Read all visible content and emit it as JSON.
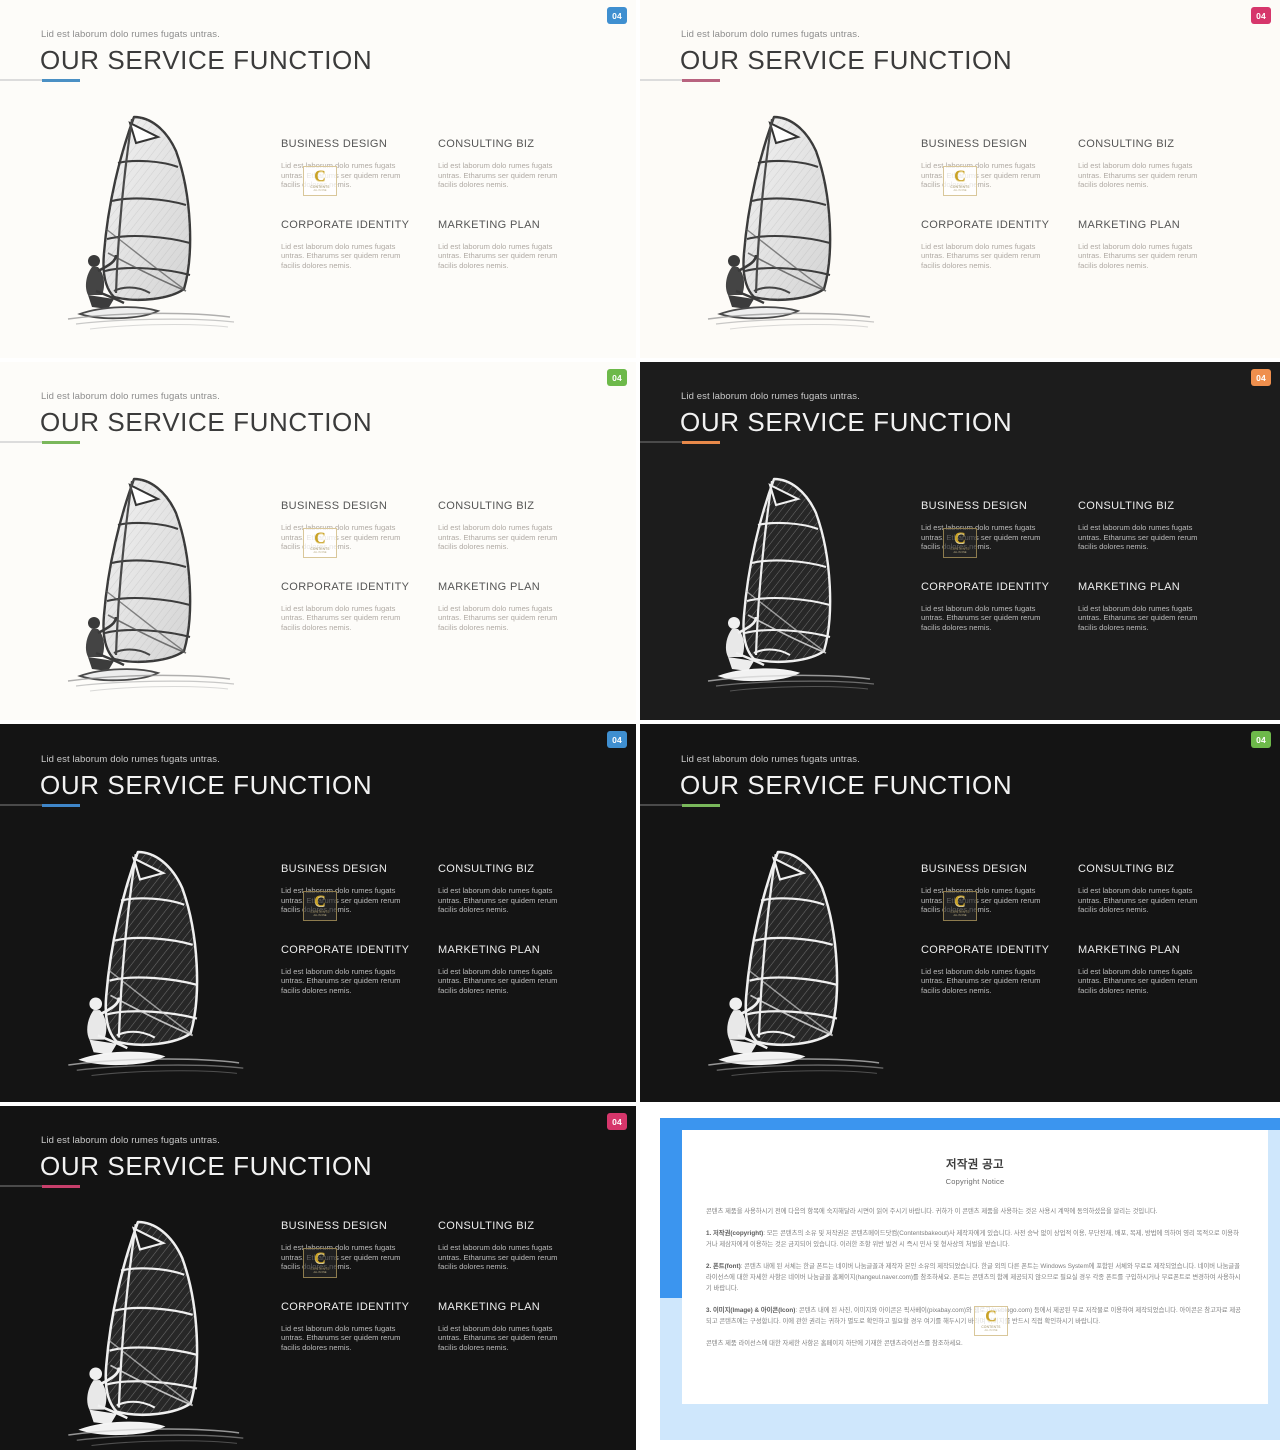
{
  "slides": [
    {
      "id": "slide-blue-light",
      "theme": "light",
      "badge": "04",
      "accent": "#4a90c4",
      "badge_color": "#3f8fd0",
      "eyebrow": "Lid est laborum dolo rumes fugats untras.",
      "title": "OUR SERVICE FUNCTION",
      "items": [
        {
          "heading": "BUSINESS DESIGN",
          "body": "Lid est laborum dolo rumes fugats untras. Etharums ser quidem rerum facilis dolores nemis."
        },
        {
          "heading": "CONSULTING BIZ",
          "body": "Lid est laborum dolo rumes fugats untras. Etharums ser quidem rerum facilis dolores nemis."
        },
        {
          "heading": "CORPORATE IDENTITY",
          "body": "Lid est laborum dolo rumes fugats untras. Etharums ser quidem rerum facilis dolores nemis."
        },
        {
          "heading": "MARKETING PLAN",
          "body": "Lid est laborum dolo rumes fugats untras. Etharums ser quidem rerum facilis dolores nemis."
        }
      ]
    },
    {
      "id": "slide-pink-light",
      "theme": "light2",
      "badge": "04",
      "accent": "#b8637f",
      "badge_color": "#d6366b",
      "eyebrow": "Lid est laborum dolo rumes fugats untras.",
      "title": "OUR SERVICE FUNCTION",
      "items": [
        {
          "heading": "BUSINESS DESIGN",
          "body": "Lid est laborum dolo rumes fugats untras. Etharums ser quidem rerum facilis dolores nemis."
        },
        {
          "heading": "CONSULTING BIZ",
          "body": "Lid est laborum dolo rumes fugats untras. Etharums ser quidem rerum facilis dolores nemis."
        },
        {
          "heading": "CORPORATE IDENTITY",
          "body": "Lid est laborum dolo rumes fugats untras. Etharums ser quidem rerum facilis dolores nemis."
        },
        {
          "heading": "MARKETING PLAN",
          "body": "Lid est laborum dolo rumes fugats untras. Etharums ser quidem rerum facilis dolores nemis."
        }
      ]
    },
    {
      "id": "slide-green-light",
      "theme": "light",
      "badge": "04",
      "accent": "#7ab75b",
      "badge_color": "#6db94a",
      "eyebrow": "Lid est laborum dolo rumes fugats untras.",
      "title": "OUR SERVICE FUNCTION",
      "items": [
        {
          "heading": "BUSINESS DESIGN",
          "body": "Lid est laborum dolo rumes fugats untras. Etharums ser quidem rerum facilis dolores nemis."
        },
        {
          "heading": "CONSULTING BIZ",
          "body": "Lid est laborum dolo rumes fugats untras. Etharums ser quidem rerum facilis dolores nemis."
        },
        {
          "heading": "CORPORATE IDENTITY",
          "body": "Lid est laborum dolo rumes fugats untras. Etharums ser quidem rerum facilis dolores nemis."
        },
        {
          "heading": "MARKETING PLAN",
          "body": "Lid est laborum dolo rumes fugats untras. Etharums ser quidem rerum facilis dolores nemis."
        }
      ]
    },
    {
      "id": "slide-orange-dark",
      "theme": "dark",
      "badge": "04",
      "accent": "#e8894a",
      "badge_color": "#ef8f4d",
      "eyebrow": "Lid est laborum dolo rumes fugats untras.",
      "title": "OUR SERVICE FUNCTION",
      "items": [
        {
          "heading": "BUSINESS DESIGN",
          "body": "Lid est laborum dolo rumes fugats untras. Etharums ser quidem rerum facilis dolores nemis."
        },
        {
          "heading": "CONSULTING BIZ",
          "body": "Lid est laborum dolo rumes fugats untras. Etharums ser quidem rerum facilis dolores nemis."
        },
        {
          "heading": "CORPORATE IDENTITY",
          "body": "Lid est laborum dolo rumes fugats untras. Etharums ser quidem rerum facilis dolores nemis."
        },
        {
          "heading": "MARKETING PLAN",
          "body": "Lid est laborum dolo rumes fugats untras. Etharums ser quidem rerum facilis dolores nemis."
        }
      ]
    },
    {
      "id": "slide-blue-dark",
      "theme": "dark2",
      "badge": "04",
      "accent": "#3f86c9",
      "badge_color": "#3f8fd0",
      "eyebrow": "Lid est laborum dolo rumes fugats untras.",
      "title": "OUR SERVICE FUNCTION",
      "items": [
        {
          "heading": "BUSINESS DESIGN",
          "body": "Lid est laborum dolo rumes fugats untras. Etharums ser quidem rerum facilis dolores nemis."
        },
        {
          "heading": "CONSULTING BIZ",
          "body": "Lid est laborum dolo rumes fugats untras. Etharums ser quidem rerum facilis dolores nemis."
        },
        {
          "heading": "CORPORATE IDENTITY",
          "body": "Lid est laborum dolo rumes fugats untras. Etharums ser quidem rerum facilis dolores nemis."
        },
        {
          "heading": "MARKETING PLAN",
          "body": "Lid est laborum dolo rumes fugats untras. Etharums ser quidem rerum facilis dolores nemis."
        }
      ]
    },
    {
      "id": "slide-green-dark",
      "theme": "dark2",
      "badge": "04",
      "accent": "#79b85b",
      "badge_color": "#6db94a",
      "eyebrow": "Lid est laborum dolo rumes fugats untras.",
      "title": "OUR SERVICE FUNCTION",
      "items": [
        {
          "heading": "BUSINESS DESIGN",
          "body": "Lid est laborum dolo rumes fugats untras. Etharums ser quidem rerum facilis dolores nemis."
        },
        {
          "heading": "CONSULTING BIZ",
          "body": "Lid est laborum dolo rumes fugats untras. Etharums ser quidem rerum facilis dolores nemis."
        },
        {
          "heading": "CORPORATE IDENTITY",
          "body": "Lid est laborum dolo rumes fugats untras. Etharums ser quidem rerum facilis dolores nemis."
        },
        {
          "heading": "MARKETING PLAN",
          "body": "Lid est laborum dolo rumes fugats untras. Etharums ser quidem rerum facilis dolores nemis."
        }
      ]
    },
    {
      "id": "slide-pink-dark",
      "theme": "dark3",
      "badge": "04",
      "accent": "#c73f6b",
      "badge_color": "#d6366b",
      "eyebrow": "Lid est laborum dolo rumes fugats untras.",
      "title": "OUR SERVICE FUNCTION",
      "items": [
        {
          "heading": "BUSINESS DESIGN",
          "body": "Lid est laborum dolo rumes fugats untras. Etharums ser quidem rerum facilis dolores nemis."
        },
        {
          "heading": "CONSULTING BIZ",
          "body": "Lid est laborum dolo rumes fugats untras. Etharums ser quidem rerum facilis dolores nemis."
        },
        {
          "heading": "CORPORATE IDENTITY",
          "body": "Lid est laborum dolo rumes fugats untras. Etharums ser quidem rerum facilis dolores nemis."
        },
        {
          "heading": "MARKETING PLAN",
          "body": "Lid est laborum dolo rumes fugats untras. Etharums ser quidem rerum facilis dolores nemis."
        }
      ]
    }
  ],
  "watermark": {
    "letter": "C",
    "line1": "CONTENTS",
    "line2": "ALL IN ONE"
  },
  "copyright": {
    "title": "저작권 공고",
    "subtitle": "Copyright Notice",
    "intro": "콘텐츠 제품을 사용하시기 전에 다음의 항목에 숙지해달라 시면이 읽어 주시기 바랍니다. 귀하가 이 콘텐츠 제품을 사용하는 것은 사용시 계약에 동의하셨음을 알리는 것입니다.",
    "p1_label": "1. 저작권(copyright)",
    "p1": ": 모든 콘텐츠의 소유 및 저작권은 콘텐츠메이드닷컴(Contentsbakeout)사 제작자에게 있습니다. 사전 승낙 없이 상업적 이용, 무단전재, 배포, 복제, 방법에 의하여 영리 목적으로 이용하거나 제삼자에게 이용하는 것은 금지되어 있습니다. 이러한 조항 위반 발견 시 즉시 민사 및 형사상의 처벌을 받습니다.",
    "p2_label": "2. 폰트(font)",
    "p2": ": 콘텐츠 내에 된 서체는 한글 폰트는 네이버 나눔글꼴과 제작자 본인 소유의 제작되었습니다. 한글 외의 다른 폰트는 Windows System에 포함된 서체와 무료로 제작되었습니다. 네이버 나눔글꼴 라이선스에 대한 자세한 사항은 네이버 나눔글꼴 홈페이지(hangeul.naver.com)를 참조하세요. 폰트는 콘텐츠의 함께 제공되지 않으므로 필요실 경우 각종 폰트를 구입하시거나 무료폰트로 변경하여 사용하시기 바랍니다.",
    "p3_label": "3. 이미지(Image) & 아이콘(Icon)",
    "p3": ": 콘텐츠 내에 된 사진, 이미지와 아이콘은 픽사베이(pixabay.com)와 웹로고(weblogo.com) 등에서 제공된 무료 저작물로 이용하여 제작되었습니다. 아이콘은 참고자료 제공되고 콘텐츠에는 구성합니다. 이에 관한 권리는 귀하가 별도로 확인하고 필요할 경우 여기를 해두시기 바라며 이미지를 반드시 직접 확인하시기 바랍니다.",
    "footer": "콘텐츠 제품 라이선스에 대한 자세한 사항은 홈페이지 하단에 기재한 콘텐츠라이선스를 참조하세요."
  }
}
